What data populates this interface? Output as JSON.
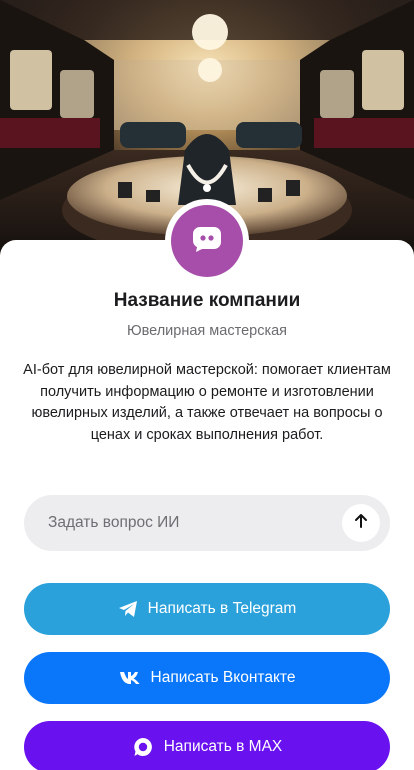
{
  "profile": {
    "company_name": "Название компании",
    "category": "Ювелирная мастерская",
    "description": "AI-бот для ювелирной мастерской: помогает клиентам получить информацию о ремонте и изготовлении ювелирных изделий, а также отвечает на вопросы о ценах и сроках выполнения работ.",
    "avatar_icon": "chat-bot-icon",
    "avatar_color": "#a64ea9"
  },
  "ask": {
    "placeholder": "Задать вопрос ИИ",
    "send_icon": "arrow-up-icon"
  },
  "buttons": {
    "telegram": {
      "label": "Написать в Telegram",
      "icon": "telegram-icon",
      "color": "#2aa1da"
    },
    "vk": {
      "label": "Написать Вконтакте",
      "icon": "vk-icon",
      "color": "#0a77fb"
    },
    "max": {
      "label": "Написать в MAX",
      "icon": "max-icon",
      "color": "#6a11f0"
    }
  }
}
